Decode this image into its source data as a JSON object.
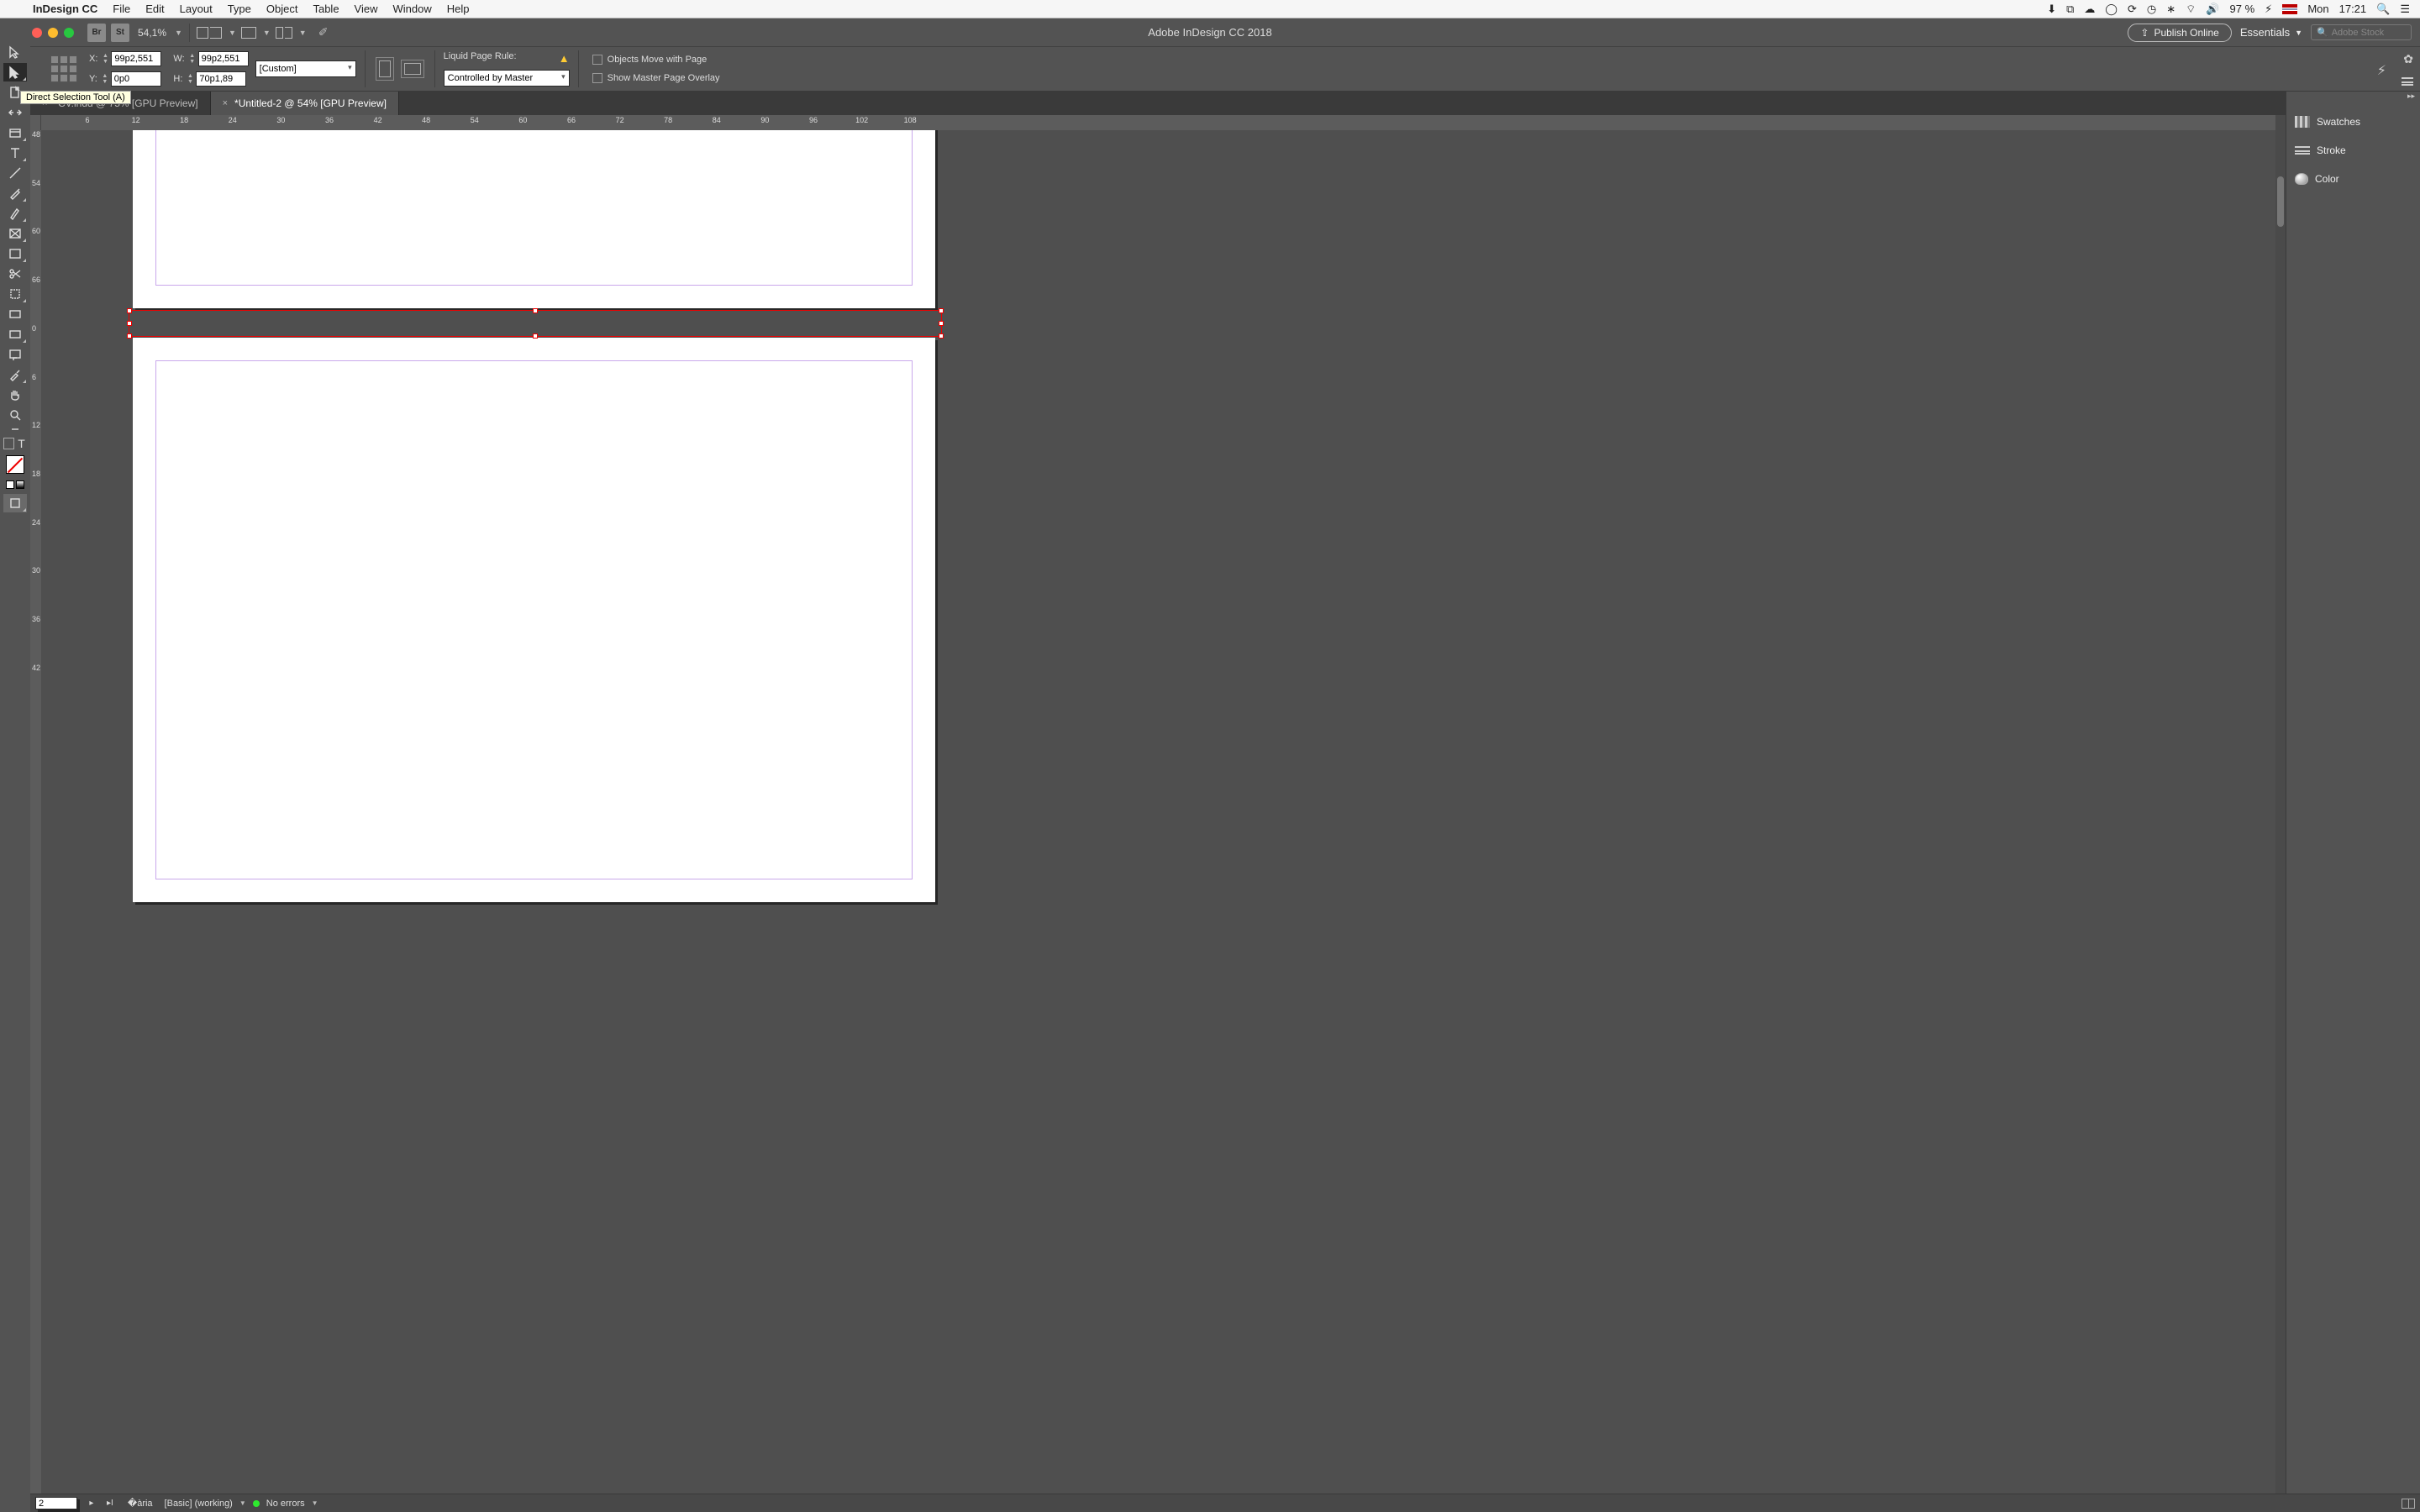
{
  "menubar": {
    "app_name": "InDesign CC",
    "items": [
      "File",
      "Edit",
      "Layout",
      "Type",
      "Object",
      "Table",
      "View",
      "Window",
      "Help"
    ],
    "battery": "97 %",
    "day": "Mon",
    "time": "17:21"
  },
  "appbar": {
    "br": "Br",
    "st": "St",
    "zoom": "54,1%",
    "title": "Adobe InDesign CC 2018",
    "publish": "Publish Online",
    "workspace": "Essentials",
    "search_placeholder": "Adobe Stock"
  },
  "tooltip": "Direct Selection Tool (A)",
  "ctrl": {
    "x_label": "X:",
    "x": "99p2,551",
    "y_label": "Y:",
    "y": "0p0",
    "w_label": "W:",
    "w": "99p2,551",
    "h_label": "H:",
    "h": "70p1,89",
    "preset": "[Custom]",
    "liquid_label": "Liquid Page Rule:",
    "liquid_rule": "Controlled by Master",
    "chk_move": "Objects Move with Page",
    "chk_overlay": "Show Master Page Overlay"
  },
  "tabs": [
    {
      "label": "*CV.indd @ 75% [GPU Preview]",
      "active": false
    },
    {
      "label": "*Untitled-2 @ 54% [GPU Preview]",
      "active": true
    }
  ],
  "ruler_h_start": 6,
  "ruler_h_step": 6,
  "ruler_h_count": 18,
  "ruler_v": [
    "48",
    "54",
    "60",
    "66",
    "0",
    "6",
    "12",
    "18",
    "24",
    "30",
    "36",
    "42"
  ],
  "right_panels": [
    "Swatches",
    "Stroke",
    "Color"
  ],
  "status": {
    "page": "2",
    "style": "[Basic] (working)",
    "errors": "No errors"
  }
}
